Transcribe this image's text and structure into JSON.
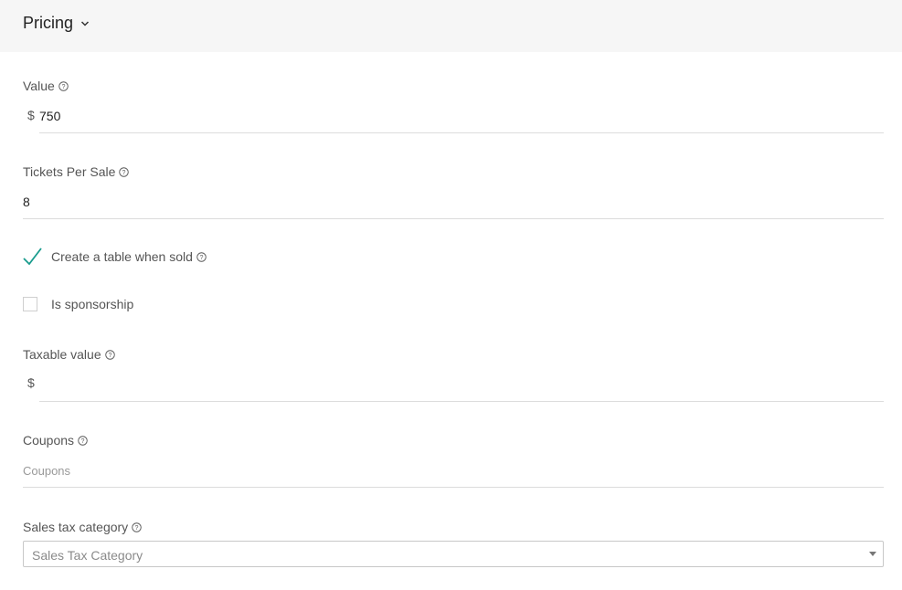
{
  "section": {
    "title": "Pricing",
    "toggle_icon": "chevron-down-icon"
  },
  "fields": {
    "value": {
      "label": "Value",
      "currency": "$",
      "value": "750"
    },
    "tickets_per_sale": {
      "label": "Tickets Per Sale",
      "value": "8"
    },
    "create_table": {
      "label": "Create a table when sold",
      "checked": true
    },
    "is_sponsorship": {
      "label": "Is sponsorship",
      "checked": false
    },
    "taxable_value": {
      "label": "Taxable value",
      "currency": "$",
      "value": ""
    },
    "coupons": {
      "label": "Coupons",
      "placeholder": "Coupons",
      "value": ""
    },
    "sales_tax_category": {
      "label": "Sales tax category",
      "placeholder": "Sales Tax Category"
    }
  },
  "colors": {
    "header_bg": "#f6f6f6",
    "check": "#1a9c8e",
    "underline": "#dcdcdc"
  }
}
